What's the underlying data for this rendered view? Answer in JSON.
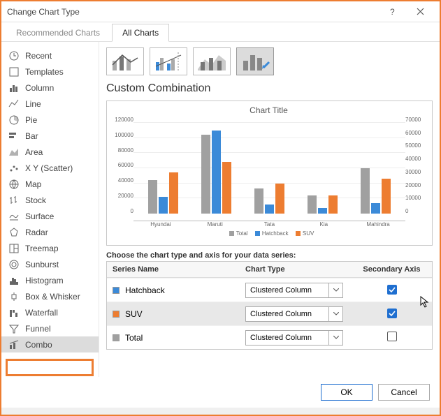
{
  "window": {
    "title": "Change Chart Type"
  },
  "tabs": {
    "recommended": "Recommended Charts",
    "all": "All Charts"
  },
  "sidebar": {
    "items": [
      {
        "label": "Recent"
      },
      {
        "label": "Templates"
      },
      {
        "label": "Column"
      },
      {
        "label": "Line"
      },
      {
        "label": "Pie"
      },
      {
        "label": "Bar"
      },
      {
        "label": "Area"
      },
      {
        "label": "X Y (Scatter)"
      },
      {
        "label": "Map"
      },
      {
        "label": "Stock"
      },
      {
        "label": "Surface"
      },
      {
        "label": "Radar"
      },
      {
        "label": "Treemap"
      },
      {
        "label": "Sunburst"
      },
      {
        "label": "Histogram"
      },
      {
        "label": "Box & Whisker"
      },
      {
        "label": "Waterfall"
      },
      {
        "label": "Funnel"
      },
      {
        "label": "Combo"
      }
    ]
  },
  "main": {
    "section_title": "Custom Combination",
    "chart_title": "Chart Title"
  },
  "chart_data": {
    "type": "bar",
    "categories": [
      "Hyundai",
      "Maruti",
      "Tata",
      "Kia",
      "Mahindra"
    ],
    "series": [
      {
        "name": "Total",
        "axis": "primary",
        "values": [
          44000,
          104000,
          33000,
          24000,
          60000
        ]
      },
      {
        "name": "Hatchback",
        "axis": "primary",
        "values": [
          22000,
          110000,
          12000,
          7000,
          14000
        ]
      },
      {
        "name": "SUV",
        "axis": "secondary",
        "values": [
          32000,
          40000,
          23000,
          14000,
          27000
        ]
      }
    ],
    "ylabel": "",
    "xlabel": "",
    "y_primary": {
      "min": 0,
      "max": 120000,
      "step": 20000
    },
    "y_secondary": {
      "min": 0,
      "max": 70000,
      "step": 10000
    },
    "legend": [
      "Total",
      "Hatchback",
      "SUV"
    ],
    "colors": {
      "Total": "#a0a0a0",
      "Hatchback": "#3b8ad8",
      "SUV": "#ED7D31"
    }
  },
  "series_cfg": {
    "instruction": "Choose the chart type and axis for your data series:",
    "headers": {
      "name": "Series Name",
      "type": "Chart Type",
      "sec": "Secondary Axis"
    },
    "rows": [
      {
        "name": "Hatchback",
        "color": "#3b8ad8",
        "chart_type": "Clustered Column",
        "secondary": true,
        "selected": false
      },
      {
        "name": "SUV",
        "color": "#ED7D31",
        "chart_type": "Clustered Column",
        "secondary": true,
        "selected": true
      },
      {
        "name": "Total",
        "color": "#a0a0a0",
        "chart_type": "Clustered Column",
        "secondary": false,
        "selected": false
      }
    ]
  },
  "footer": {
    "ok": "OK",
    "cancel": "Cancel"
  }
}
